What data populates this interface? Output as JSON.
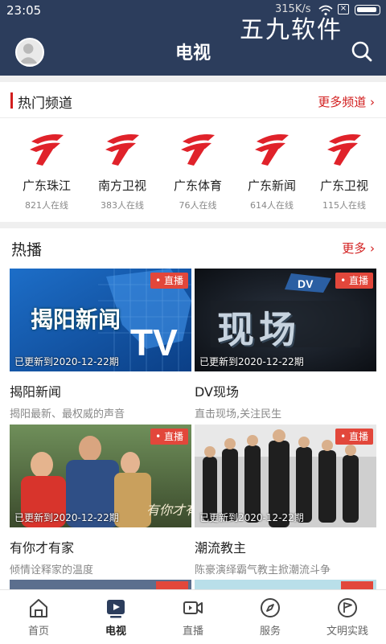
{
  "status_bar": {
    "time": "23:05",
    "network_speed": "315K/s"
  },
  "watermark": "五九软件",
  "header": {
    "title": "电视"
  },
  "hot_channels": {
    "title": "热门频道",
    "more_label": "更多频道 ›",
    "channels": [
      {
        "name": "广东珠江",
        "viewers": "821人在线"
      },
      {
        "name": "南方卫视",
        "viewers": "383人在线"
      },
      {
        "name": "广东体育",
        "viewers": "76人在线"
      },
      {
        "name": "广东新闻",
        "viewers": "614人在线"
      },
      {
        "name": "广东卫视",
        "viewers": "115人在线"
      }
    ]
  },
  "hot_shows": {
    "title": "热播",
    "more_label": "更多 ›",
    "live_label": "• 直播",
    "cards": [
      {
        "title": "揭阳新闻",
        "desc": "揭阳最新、最权威的声音",
        "update": "已更新到2020-12-22期",
        "thumb_text": "揭阳新闻"
      },
      {
        "title": "DV现场",
        "desc": "直击现场,关注民生",
        "update": "已更新到2020-12-22期",
        "thumb_text": "现场"
      },
      {
        "title": "有你才有家",
        "desc": "倾情诠释家的温度",
        "update": "已更新到2020-12-22期",
        "thumb_text": ""
      },
      {
        "title": "潮流教主",
        "desc": "陈豪演绎霸气教主掀潮流斗争",
        "update": "已更新到2020-12-22期",
        "thumb_text": ""
      }
    ]
  },
  "tab_bar": {
    "tabs": [
      {
        "label": "首页",
        "icon": "home-icon"
      },
      {
        "label": "电视",
        "icon": "tv-play-icon",
        "active": true
      },
      {
        "label": "直播",
        "icon": "video-camera-icon"
      },
      {
        "label": "服务",
        "icon": "compass-icon"
      },
      {
        "label": "文明实践",
        "icon": "flag-circle-icon"
      }
    ]
  },
  "colors": {
    "header_bg": "#2c3d5c",
    "accent_red": "#d21e1e",
    "live_badge": "#e2473b"
  }
}
